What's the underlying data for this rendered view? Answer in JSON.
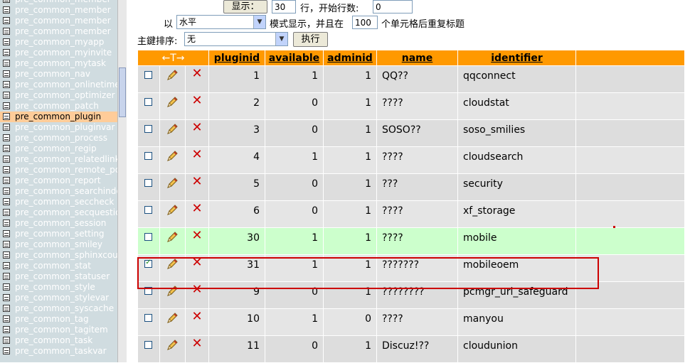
{
  "sidebar": {
    "items": [
      "pre_common_member",
      "pre_common_member",
      "pre_common_member",
      "pre_common_member",
      "pre_common_myapp",
      "pre_common_myinvite",
      "pre_common_mytask",
      "pre_common_nav",
      "pre_common_onlinetime",
      "pre_common_optimizer",
      "pre_common_patch",
      "pre_common_plugin",
      "pre_common_pluginvar",
      "pre_common_process",
      "pre_common_regip",
      "pre_common_relatedlink",
      "pre_common_remote_port",
      "pre_common_report",
      "pre_common_searchindex",
      "pre_common_seccheck",
      "pre_common_secquestion",
      "pre_common_session",
      "pre_common_setting",
      "pre_common_smiley",
      "pre_common_sphinxcounter",
      "pre_common_stat",
      "pre_common_statuser",
      "pre_common_style",
      "pre_common_stylevar",
      "pre_common_syscache",
      "pre_common_tag",
      "pre_common_tagitem",
      "pre_common_task",
      "pre_common_taskvar"
    ],
    "active_index": 11
  },
  "controls": {
    "show_button": "显示：",
    "rows_value": "30",
    "rows_label": "行，开始行数:",
    "start_value": "0",
    "in_label": "以",
    "mode_value": "水平",
    "mode_label": "模式显示，并且在",
    "repeat_value": "100",
    "repeat_label": "个单元格后重复标题",
    "sort_label": "主鍵排序:",
    "sort_value": "无",
    "exec_button": "执行"
  },
  "table": {
    "arrows_label": "←T→",
    "columns": [
      "pluginid",
      "available",
      "adminid",
      "name",
      "identifier"
    ],
    "rows": [
      {
        "pluginid": "1",
        "available": "1",
        "adminid": "1",
        "name": "QQ??",
        "identifier": "qqconnect",
        "checked": false,
        "state": "normal"
      },
      {
        "pluginid": "2",
        "available": "0",
        "adminid": "1",
        "name": "????",
        "identifier": "cloudstat",
        "checked": false,
        "state": "normal"
      },
      {
        "pluginid": "3",
        "available": "0",
        "adminid": "1",
        "name": "SOSO??",
        "identifier": "soso_smilies",
        "checked": false,
        "state": "normal"
      },
      {
        "pluginid": "4",
        "available": "1",
        "adminid": "1",
        "name": "????",
        "identifier": "cloudsearch",
        "checked": false,
        "state": "normal"
      },
      {
        "pluginid": "5",
        "available": "0",
        "adminid": "1",
        "name": "???",
        "identifier": "security",
        "checked": false,
        "state": "normal"
      },
      {
        "pluginid": "6",
        "available": "0",
        "adminid": "1",
        "name": "????",
        "identifier": "xf_storage",
        "checked": false,
        "state": "normal"
      },
      {
        "pluginid": "30",
        "available": "1",
        "adminid": "1",
        "name": "????",
        "identifier": "mobile",
        "checked": false,
        "state": "hover"
      },
      {
        "pluginid": "31",
        "available": "1",
        "adminid": "1",
        "name": "???????",
        "identifier": "mobileoem",
        "checked": true,
        "state": "marked"
      },
      {
        "pluginid": "9",
        "available": "0",
        "adminid": "1",
        "name": "????????",
        "identifier": "pcmgr_url_safeguard",
        "checked": false,
        "state": "normal"
      },
      {
        "pluginid": "10",
        "available": "1",
        "adminid": "0",
        "name": "????",
        "identifier": "manyou",
        "checked": false,
        "state": "normal"
      },
      {
        "pluginid": "11",
        "available": "0",
        "adminid": "1",
        "name": "Discuz!??",
        "identifier": "cloudunion",
        "checked": false,
        "state": "normal"
      }
    ]
  },
  "colors": {
    "header": "#ff9900",
    "row": "#dddddd",
    "hover": "#ccffcc",
    "marked": "#ffcc99",
    "highlight_box": "#cc0000",
    "sidebar_active": "#ffcc99"
  },
  "icons": [
    "table-icon",
    "pencil-icon",
    "delete-x-icon",
    "checkbox-icon"
  ]
}
